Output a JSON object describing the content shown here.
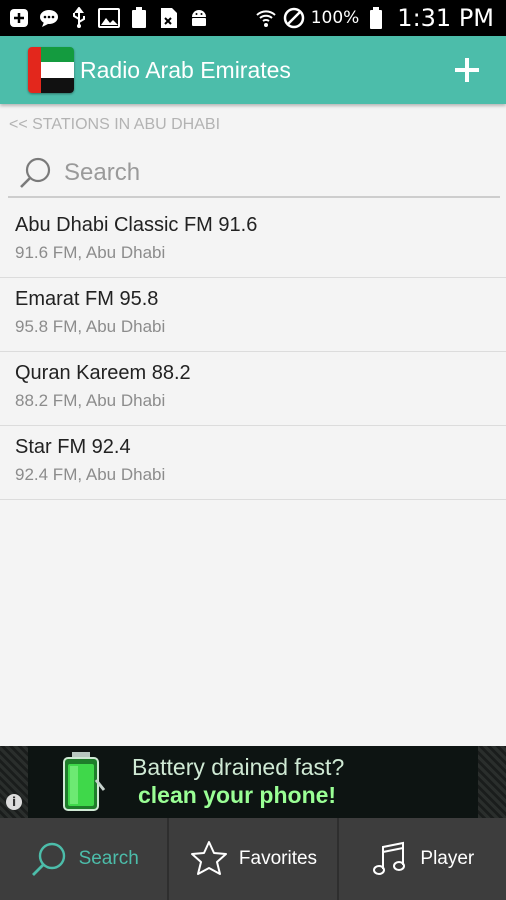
{
  "status_bar": {
    "battery_percent": "100%",
    "time": "1:31 PM"
  },
  "app_bar": {
    "title": "Radio Arab Emirates",
    "add_icon": "plus-icon"
  },
  "breadcrumb": "<< STATIONS IN ABU DHABI",
  "search": {
    "placeholder": "Search",
    "value": ""
  },
  "stations": [
    {
      "name": "Abu Dhabi Classic FM 91.6",
      "detail": "91.6 FM, Abu Dhabi"
    },
    {
      "name": "Emarat FM 95.8",
      "detail": "95.8 FM, Abu Dhabi"
    },
    {
      "name": "Quran Kareem 88.2",
      "detail": "88.2 FM, Abu Dhabi"
    },
    {
      "name": "Star FM 92.4",
      "detail": "92.4 FM, Abu Dhabi"
    }
  ],
  "ad": {
    "line1": "Battery drained fast?",
    "line2": "clean your phone!"
  },
  "bottom_nav": [
    {
      "label": "Search",
      "icon": "search-icon",
      "active": true
    },
    {
      "label": "Favorites",
      "icon": "star-icon",
      "active": false
    },
    {
      "label": "Player",
      "icon": "music-note-icon",
      "active": false
    }
  ],
  "colors": {
    "accent": "#4cbdaa",
    "nav_bg": "#3d3d3d"
  }
}
